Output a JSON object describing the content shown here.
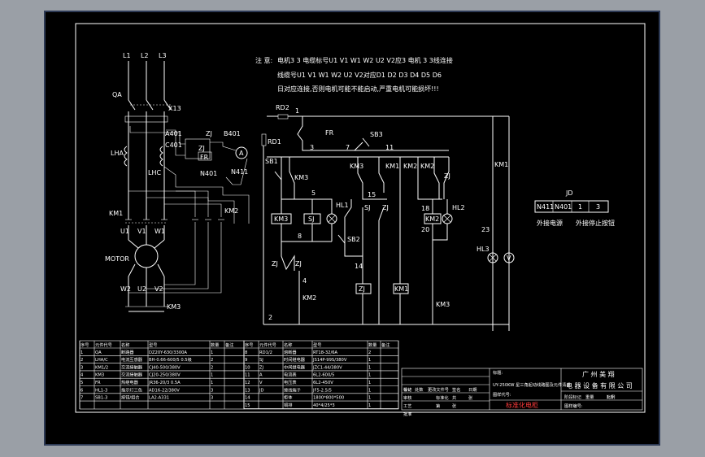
{
  "phases": [
    "L1",
    "L2",
    "L3"
  ],
  "labels": {
    "qa": "QA",
    "x13": "X13",
    "a401": "A401",
    "c401": "C401",
    "zj": "ZJ",
    "b401": "B401",
    "fr": "FR",
    "ammeter": "A",
    "lha": "LHA",
    "lhc": "LHC",
    "n401": "N401",
    "n411": "N411",
    "km1": "KM1",
    "km2": "KM2",
    "km3": "KM3",
    "u1": "U1",
    "v1": "V1",
    "w1": "W1",
    "motor": "MOTOR",
    "w2": "W2",
    "u2": "U2",
    "v2": "V2",
    "rd1": "RD1",
    "rd2": "RD2",
    "sb1": "SB1",
    "sb2": "SB2",
    "sb3": "SB3",
    "sj": "SJ",
    "hl1": "HL1",
    "hl2": "HL2",
    "hl3": "HL3",
    "voltmeter": "V",
    "jd": "JD",
    "n1": "1",
    "n2": "2",
    "n3": "3",
    "n4": "4",
    "n5": "5",
    "n7": "7",
    "n8": "8",
    "n11": "11",
    "n14": "14",
    "n15": "15",
    "n18": "18",
    "n20": "20",
    "n23": "23"
  },
  "note": {
    "title": "注 意:",
    "line1": "电机3 3 电缆标号U1 V1 W1 W2 U2 V2应3 电机 3 3线连接",
    "line2": "线缆号U1 V1 W1 W2 U2 V2对应D1 D2 D3 D4 D5 D6",
    "line3": "日对应连接,否则电机可能不能启动,严重电机可能损坏!!!"
  },
  "jd_terminals": [
    "N411",
    "N401",
    "1",
    "3"
  ],
  "jd_captions": [
    "外接电源",
    "外接停止按钮"
  ],
  "bom": {
    "headers": [
      "序号",
      "元件代号",
      "名称",
      "型号",
      "数量",
      "备注"
    ],
    "left_rows": [
      [
        "1",
        "QA",
        "断路器",
        "DZ20Y-630/3300A",
        "1",
        ""
      ],
      [
        "2",
        "LHA/C",
        "电流互感器",
        "BH-0.66-600/5 0.5级",
        "2",
        ""
      ],
      [
        "3",
        "KM1/2",
        "交流接触器",
        "CJ40-500/380V",
        "2",
        ""
      ],
      [
        "4",
        "KM3",
        "交流接触器",
        "CJ20-250/380V",
        "1",
        ""
      ],
      [
        "5",
        "FR",
        "热继电器",
        "JR36-20/3 0.5A",
        "1",
        ""
      ],
      [
        "6",
        "HL1-3",
        "指示灯三色",
        "AD16-22/380V",
        "3",
        ""
      ],
      [
        "7",
        "SB1-3",
        "按钮/组合",
        "LA2-A331",
        "3",
        ""
      ]
    ],
    "right_rows": [
      [
        "8",
        "RD1/2",
        "熔断器",
        "RT18-32/6A",
        "2",
        ""
      ],
      [
        "9",
        "SJ",
        "时间继电器",
        "JS14P-99S/380V",
        "1",
        ""
      ],
      [
        "10",
        "ZJ",
        "中间继电器",
        "JZC1-44/380V",
        "1",
        ""
      ],
      [
        "11",
        "A",
        "电流表",
        "6L2-600/5",
        "1",
        ""
      ],
      [
        "12",
        "V",
        "电压表",
        "6L2-450V",
        "1",
        ""
      ],
      [
        "13",
        "JD",
        "接线端子",
        "JF5-2.5/5",
        "1",
        ""
      ],
      [
        "14",
        "",
        "柜体",
        "1800*800*500",
        "1",
        ""
      ],
      [
        "15",
        "",
        "铜排",
        "40*4/25*3",
        "1",
        ""
      ]
    ]
  },
  "title_block": {
    "label": "标题:",
    "title": "UY-250KW 星三角起动线路图及元件清单",
    "company_line1": "广 州 美 翔",
    "company_line2": "电 器 设 备 有 限 公 司",
    "rev_header": [
      "标记",
      "处数",
      "更改文件号",
      "签名",
      "日期"
    ],
    "stage_header": [
      "阶段标记",
      "重量",
      "比例"
    ],
    "ratio": "1:1",
    "roles": [
      "设计",
      "审核",
      "工艺",
      "批准"
    ],
    "roles2": [
      "标准化",
      "共",
      "张",
      "第",
      "张"
    ],
    "drawing_no": "图样代号:",
    "standard": "标准化电柜",
    "drawing_label": "图样编号:"
  }
}
